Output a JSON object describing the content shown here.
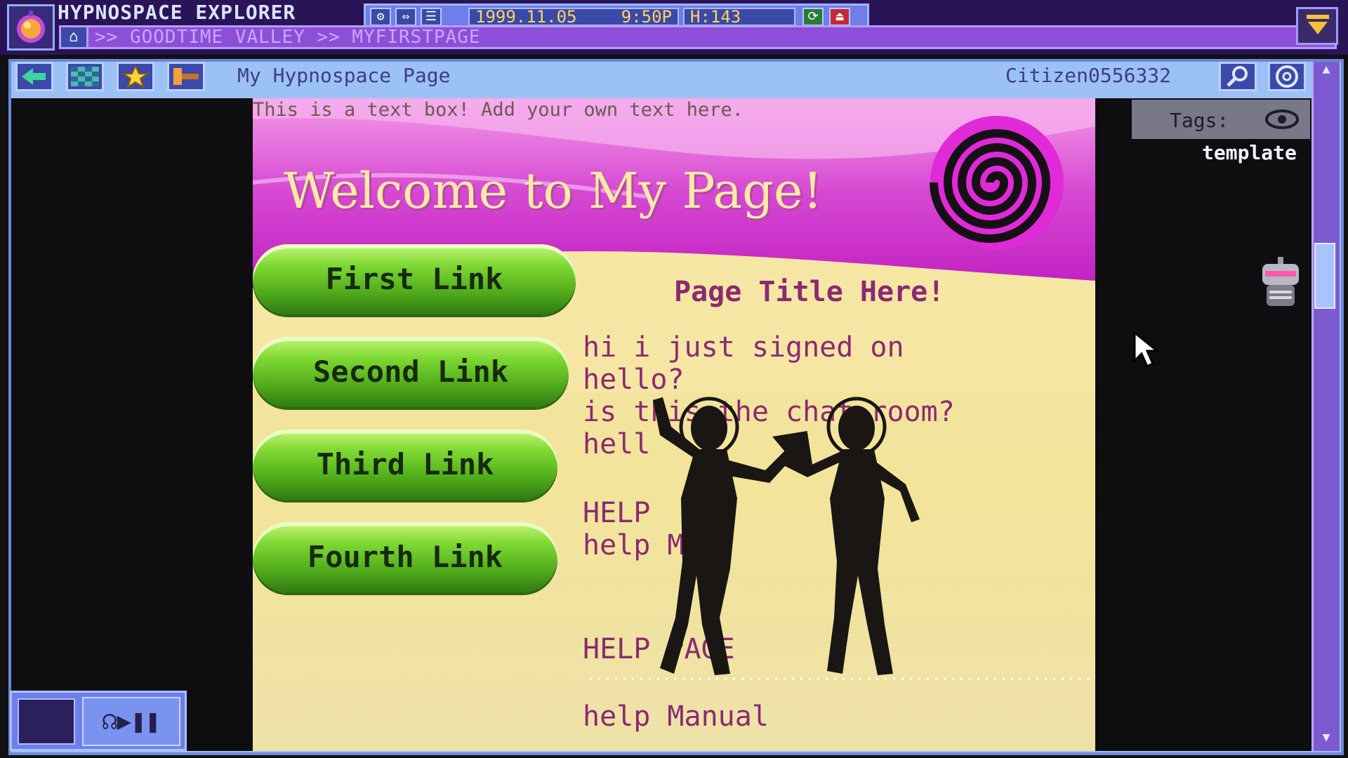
{
  "app": {
    "title": "HYPNOSPACE EXPLORER",
    "address": ">> GOODTIME VALLEY >> MYFIRSTPAGE",
    "date": "1999.11.05",
    "time": "9:50P",
    "hypnocoin": "H:143"
  },
  "toolbar": {
    "page_title": "My Hypnospace Page",
    "citizen_id": "Citizen0556332"
  },
  "sidebar": {
    "tags_label": "Tags:",
    "tag_value": "template"
  },
  "page": {
    "intro_text": "This is a text box! Add your own text here.",
    "welcome": "Welcome to My Page!",
    "heading": "Page Title Here!",
    "links": [
      {
        "label": "First Link"
      },
      {
        "label": "Second Link"
      },
      {
        "label": "Third Link"
      },
      {
        "label": "Fourth Link"
      }
    ],
    "chat_lines": [
      "hi i just signed on",
      "hello?",
      "is this the chat room?",
      "hell",
      "HELP",
      "help M",
      "HELP PAGE",
      "help Manual"
    ]
  },
  "colors": {
    "accent": "#8e4fd8",
    "frame": "#9cc1f5",
    "link_green": "#6fd029",
    "banner_magenta": "#cc1fc6"
  },
  "icons": [
    "app-orb-icon",
    "settings-icon",
    "resize-icon",
    "menu-icon",
    "refresh-icon",
    "exit-icon",
    "home-icon",
    "enter-icon",
    "minimize-icon",
    "back-icon",
    "pattern-icon",
    "star-icon",
    "hammer-icon",
    "search-icon",
    "coin-icon",
    "eye-icon",
    "robot-icon",
    "headphones-icon",
    "play-icon",
    "pause-icon",
    "cursor-icon"
  ]
}
